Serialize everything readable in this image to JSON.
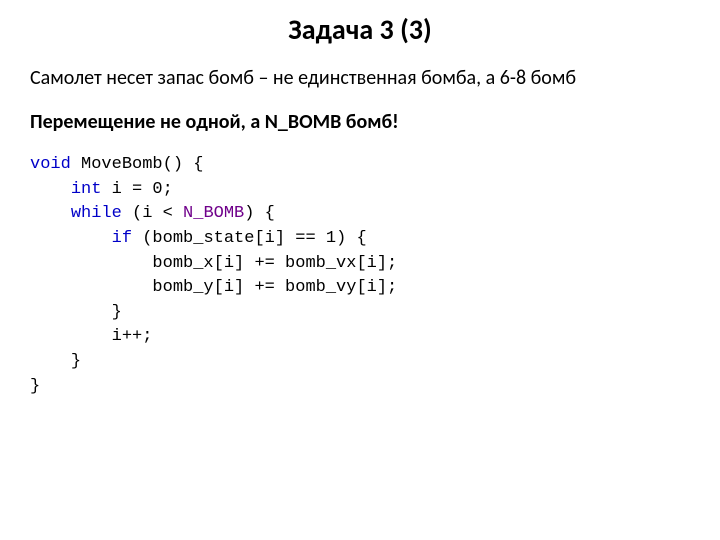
{
  "title": "Задача 3 (3)",
  "para1": "Самолет несет запас бомб – не единственная бомба, а 6-8 бомб",
  "para2": "Перемещение не одной, а N_BOMB бомб!",
  "code": {
    "l1_kw": "void",
    "l1_rest": " MoveBomb() {",
    "l2_kw": "int",
    "l2_rest": " i = 0;",
    "l3_kw": "while",
    "l3_mid": " (i < ",
    "l3_mac": "N_BOMB",
    "l3_rest": ") {",
    "l4_kw": "if",
    "l4_rest": " (bomb_state[i] == 1) {",
    "l5": "bomb_x[i] += bomb_vx[i];",
    "l6": "bomb_y[i] += bomb_vy[i];",
    "l7": "}",
    "l8": "i++;",
    "l9": "}",
    "l10": "}"
  }
}
